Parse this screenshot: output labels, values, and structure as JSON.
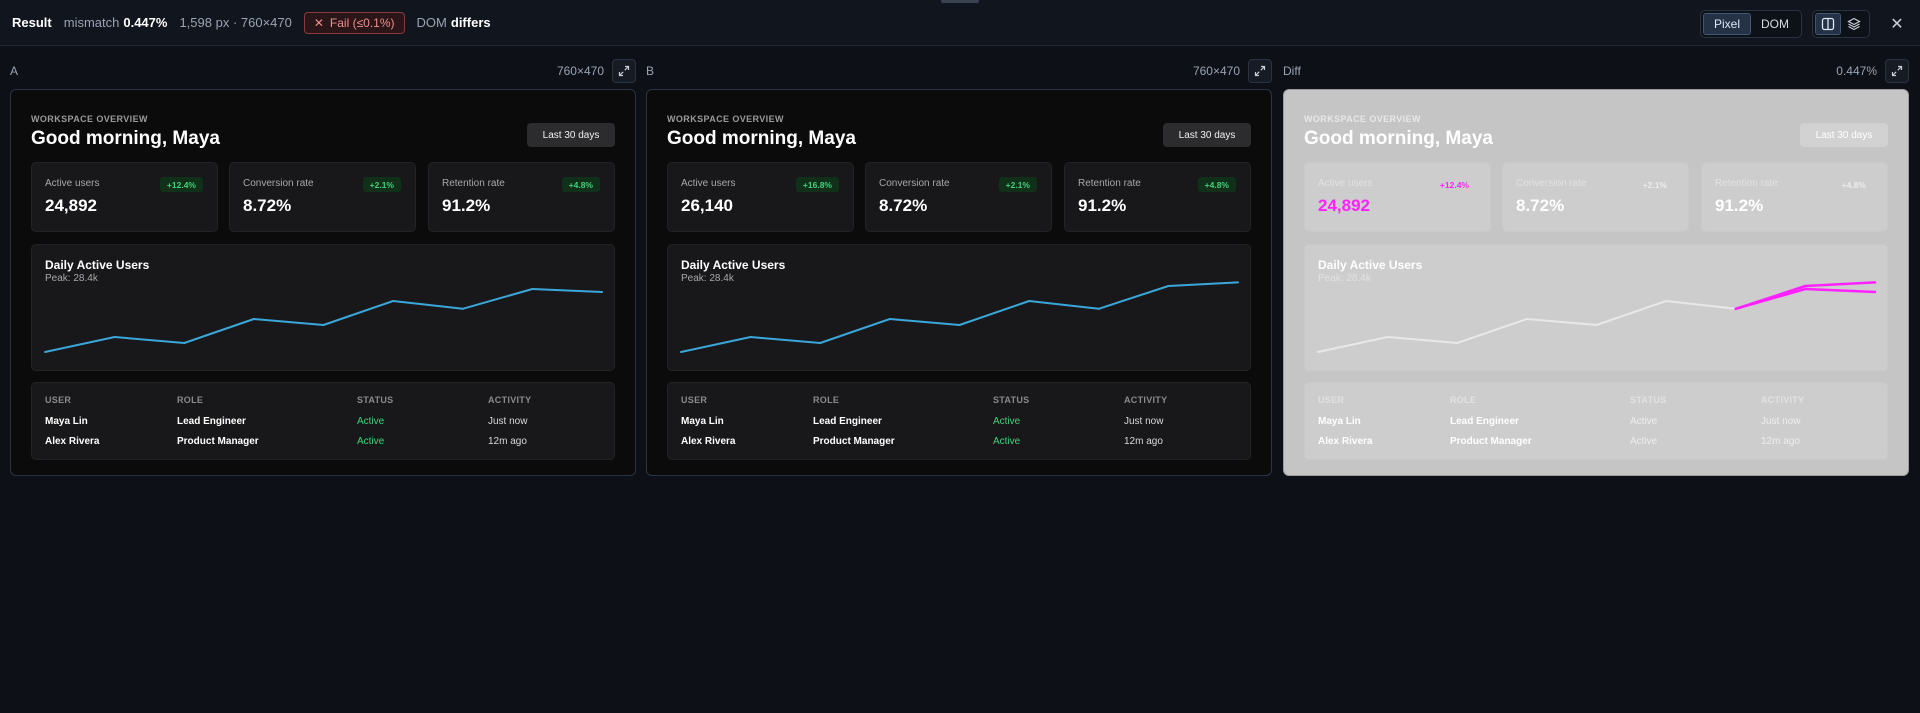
{
  "topbar": {
    "title": "Result",
    "mismatch_label": "mismatch",
    "mismatch_value": "0.447%",
    "pixels_info": "1,598 px · 760×470",
    "fail_badge": "Fail (≤0.1%)",
    "dom_label": "DOM",
    "dom_value": "differs",
    "mode_pixel": "Pixel",
    "mode_dom": "DOM",
    "active_mode": "Pixel",
    "view_icons": [
      "split-view-icon",
      "layers-icon"
    ],
    "close_icon": "close-icon"
  },
  "panels": [
    {
      "label": "A",
      "size": "760×470"
    },
    {
      "label": "B",
      "size": "760×470"
    },
    {
      "label": "Diff",
      "size": "0.447%"
    }
  ],
  "dashboards": [
    {
      "eyebrow": "WORKSPACE OVERVIEW",
      "greeting": "Good morning, Maya",
      "range_button": "Last 30 days",
      "metrics": [
        {
          "label": "Active users",
          "value": "24,892",
          "delta": "+12.4%"
        },
        {
          "label": "Conversion rate",
          "value": "8.72%",
          "delta": "+2.1%"
        },
        {
          "label": "Retention rate",
          "value": "91.2%",
          "delta": "+4.8%"
        }
      ],
      "chart_title": "Daily Active Users",
      "chart_subtitle": "Peak: 28.4k",
      "table": {
        "headers": [
          "USER",
          "ROLE",
          "STATUS",
          "ACTIVITY"
        ],
        "rows": [
          [
            "Maya Lin",
            "Lead Engineer",
            "Active",
            "Just now"
          ],
          [
            "Alex Rivera",
            "Product Manager",
            "Active",
            "12m ago"
          ]
        ]
      }
    },
    {
      "eyebrow": "WORKSPACE OVERVIEW",
      "greeting": "Good morning, Maya",
      "range_button": "Last 30 days",
      "metrics": [
        {
          "label": "Active users",
          "value": "26,140",
          "delta": "+16.8%"
        },
        {
          "label": "Conversion rate",
          "value": "8.72%",
          "delta": "+2.1%"
        },
        {
          "label": "Retention rate",
          "value": "91.2%",
          "delta": "+4.8%"
        }
      ],
      "chart_title": "Daily Active Users",
      "chart_subtitle": "Peak: 28.4k",
      "table": {
        "headers": [
          "USER",
          "ROLE",
          "STATUS",
          "ACTIVITY"
        ],
        "rows": [
          [
            "Maya Lin",
            "Lead Engineer",
            "Active",
            "Just now"
          ],
          [
            "Alex Rivera",
            "Product Manager",
            "Active",
            "12m ago"
          ]
        ]
      }
    },
    {
      "eyebrow": "WORKSPACE OVERVIEW",
      "greeting": "Good morning, Maya",
      "range_button": "Last 30 days",
      "metrics": [
        {
          "label": "Active users",
          "value": "24,892",
          "delta": "+12.4%"
        },
        {
          "label": "Conversion rate",
          "value": "8.72%",
          "delta": "+2.1%"
        },
        {
          "label": "Retention rate",
          "value": "91.2%",
          "delta": "+4.8%"
        }
      ],
      "chart_title": "Daily Active Users",
      "chart_subtitle": "Peak: 28.4k",
      "table": {
        "headers": [
          "USER",
          "ROLE",
          "STATUS",
          "ACTIVITY"
        ],
        "rows": [
          [
            "Maya Lin",
            "Lead Engineer",
            "Active",
            "Just now"
          ],
          [
            "Alex Rivera",
            "Product Manager",
            "Active",
            "12m ago"
          ]
        ]
      }
    }
  ],
  "chart_data": {
    "type": "line",
    "series": [
      {
        "name": "A",
        "values": [
          0.0,
          0.25,
          0.15,
          0.55,
          0.45,
          0.85,
          0.72,
          1.05,
          1.0
        ]
      },
      {
        "name": "B",
        "values": [
          0.0,
          0.25,
          0.15,
          0.55,
          0.45,
          0.85,
          0.72,
          1.1,
          1.16
        ]
      }
    ]
  },
  "colors": {
    "line": "#3ba7d9",
    "diff_line": "#e8e8e8",
    "diff_highlight": "#ff21ff",
    "positive": "#43d17a",
    "fail": "#f08c8c"
  }
}
